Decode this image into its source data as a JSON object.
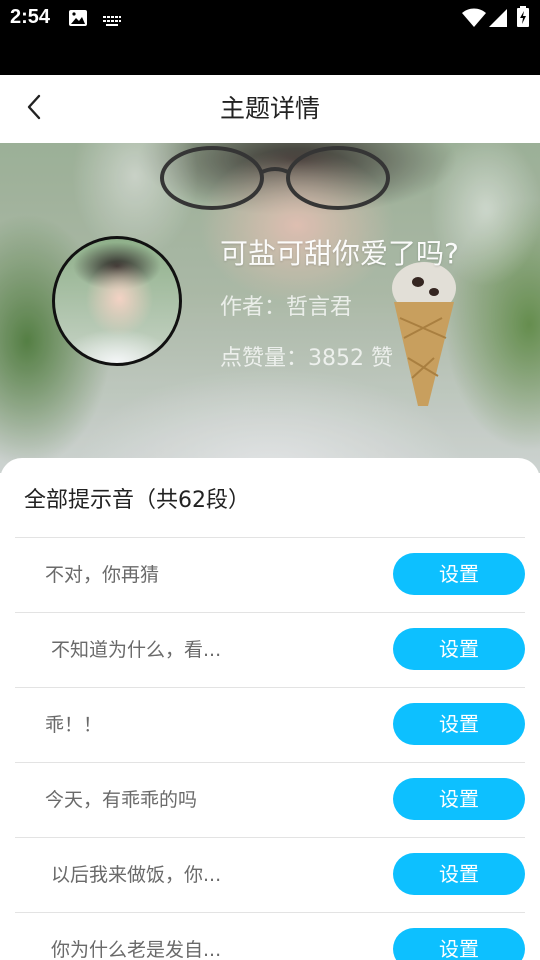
{
  "status_bar": {
    "time": "2:54"
  },
  "header": {
    "title": "主题详情"
  },
  "banner": {
    "title": "可盐可甜你爱了吗?",
    "author": "作者：哲言君",
    "likes": "点赞量：3852 赞"
  },
  "section": {
    "title": "全部提示音（共62段）"
  },
  "list": {
    "items": [
      {
        "label": "不对，你再猜",
        "button": "设置"
      },
      {
        "label": "不知道为什么，看...",
        "button": "设置"
      },
      {
        "label": "乖！！",
        "button": "设置"
      },
      {
        "label": "今天，有乖乖的吗",
        "button": "设置"
      },
      {
        "label": "以后我来做饭，你...",
        "button": "设置"
      },
      {
        "label": "你为什么老是发自...",
        "button": "设置"
      }
    ]
  },
  "colors": {
    "accent": "#0dc0ff",
    "status_bar": "#000000"
  },
  "icons": [
    "image-icon",
    "keyboard-icon",
    "wifi-icon",
    "signal-icon",
    "battery-icon",
    "back-arrow-icon"
  ]
}
